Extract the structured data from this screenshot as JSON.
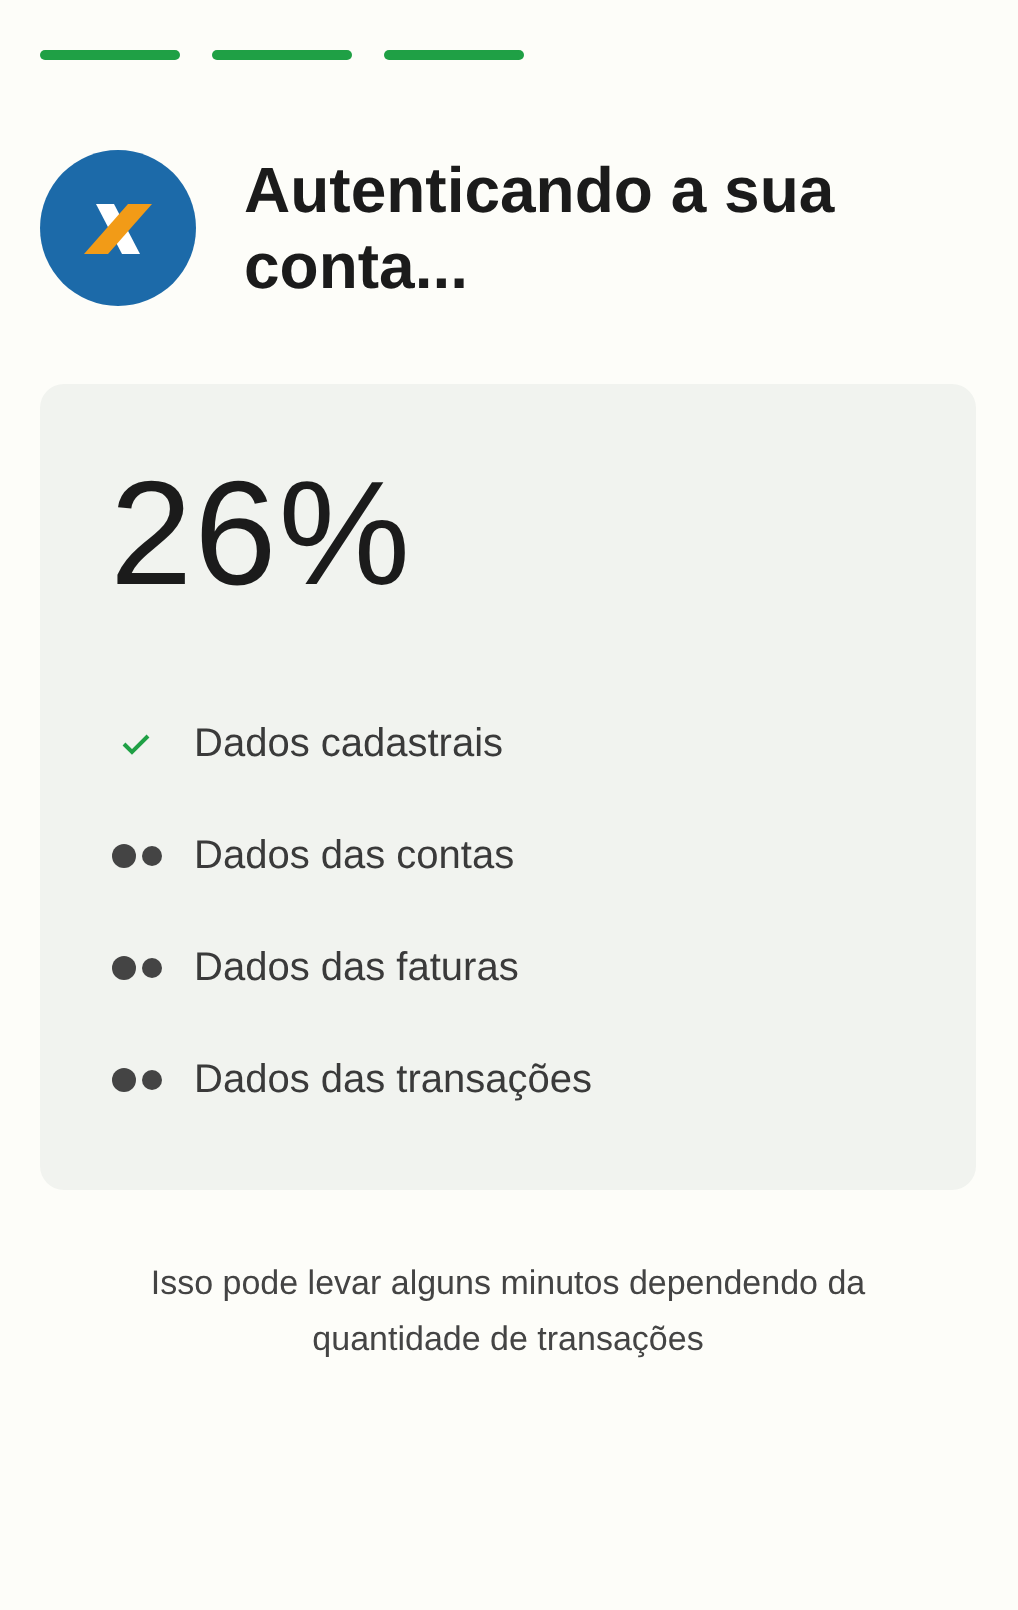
{
  "progress_steps": [
    {
      "done": true
    },
    {
      "done": true
    },
    {
      "done": true
    }
  ],
  "header": {
    "title": "Autenticando a sua conta..."
  },
  "card": {
    "percentage": "26%",
    "items": [
      {
        "label": "Dados cadastrais",
        "done": true
      },
      {
        "label": "Dados das contas",
        "done": false
      },
      {
        "label": "Dados das faturas",
        "done": false
      },
      {
        "label": "Dados das transações",
        "done": false
      }
    ]
  },
  "footer_note": "Isso pode levar alguns minutos dependendo da quantidade de transações"
}
